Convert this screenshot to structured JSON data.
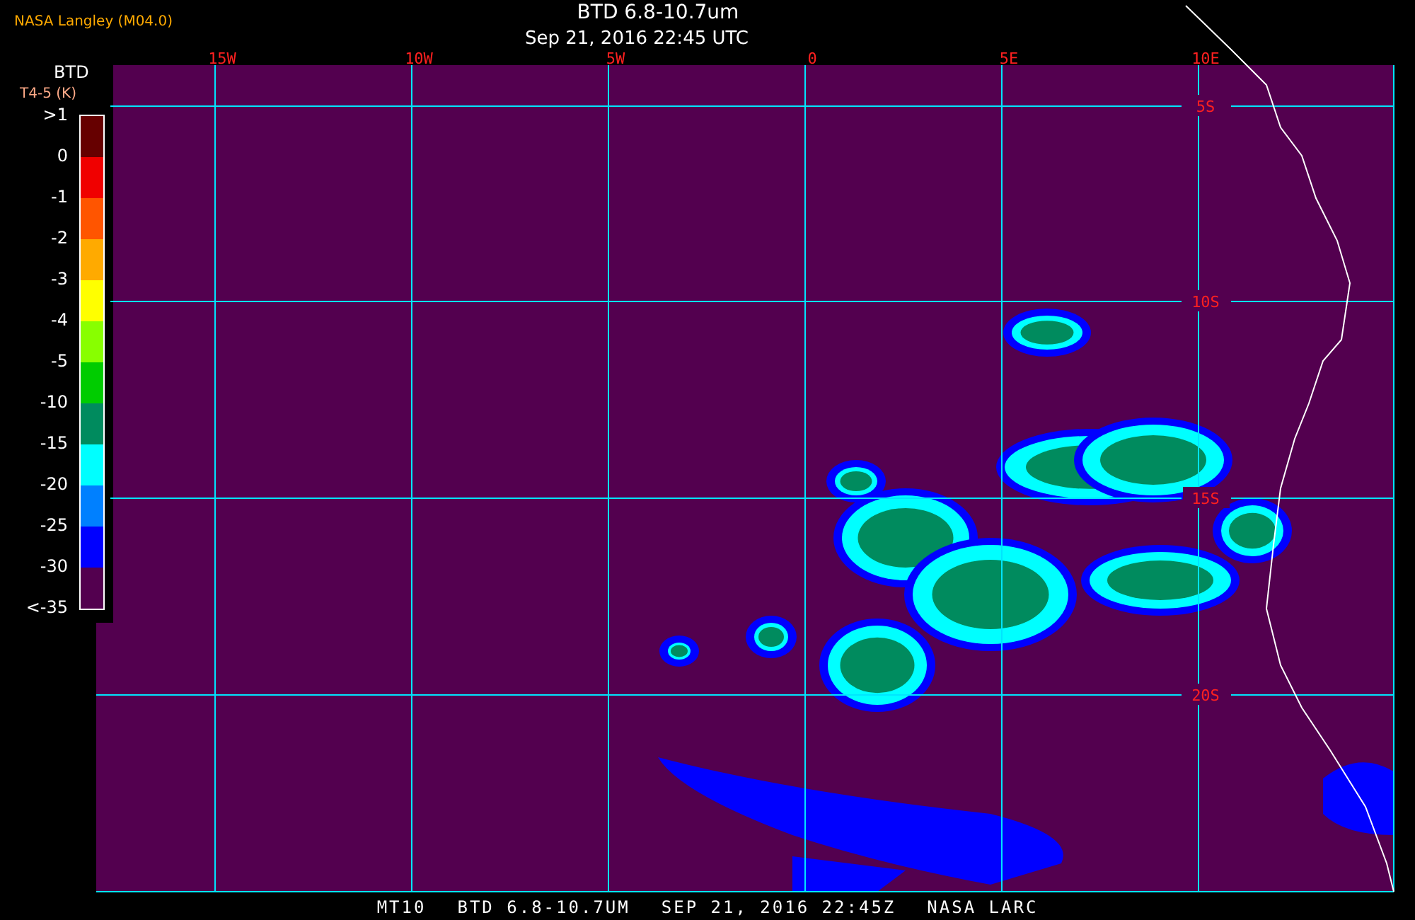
{
  "header": {
    "source": "NASA Langley (M04.0)",
    "title": "BTD 6.8-10.7um",
    "timestamp": "Sep 21, 2016 22:45 UTC"
  },
  "legend": {
    "title": "BTD",
    "unit": "T4-5 (K)",
    "labels": [
      ">1",
      "0",
      "-1",
      "-2",
      "-3",
      "-4",
      "-5",
      "-10",
      "-15",
      "-20",
      "-25",
      "-30",
      "<-35"
    ],
    "bins": [
      {
        "color": "#660000"
      },
      {
        "color": "#f00000"
      },
      {
        "color": "#ff5500"
      },
      {
        "color": "#ffaa00"
      },
      {
        "color": "#ffff00"
      },
      {
        "color": "#88ff00"
      },
      {
        "color": "#00cc00"
      },
      {
        "color": "#008b5e"
      },
      {
        "color": "#00ffff"
      },
      {
        "color": "#0080ff"
      },
      {
        "color": "#0000ff"
      },
      {
        "color": "#53004f"
      }
    ]
  },
  "map": {
    "longitude_labels": [
      "15W",
      "10W",
      "5W",
      "0",
      "5E",
      "10E"
    ],
    "latitude_labels": [
      "5S",
      "10S",
      "15S",
      "20S"
    ]
  },
  "footer": [
    "MT10",
    "BTD 6.8-10.7UM",
    "SEP 21, 2016 22:45Z",
    "NASA LARC"
  ]
}
